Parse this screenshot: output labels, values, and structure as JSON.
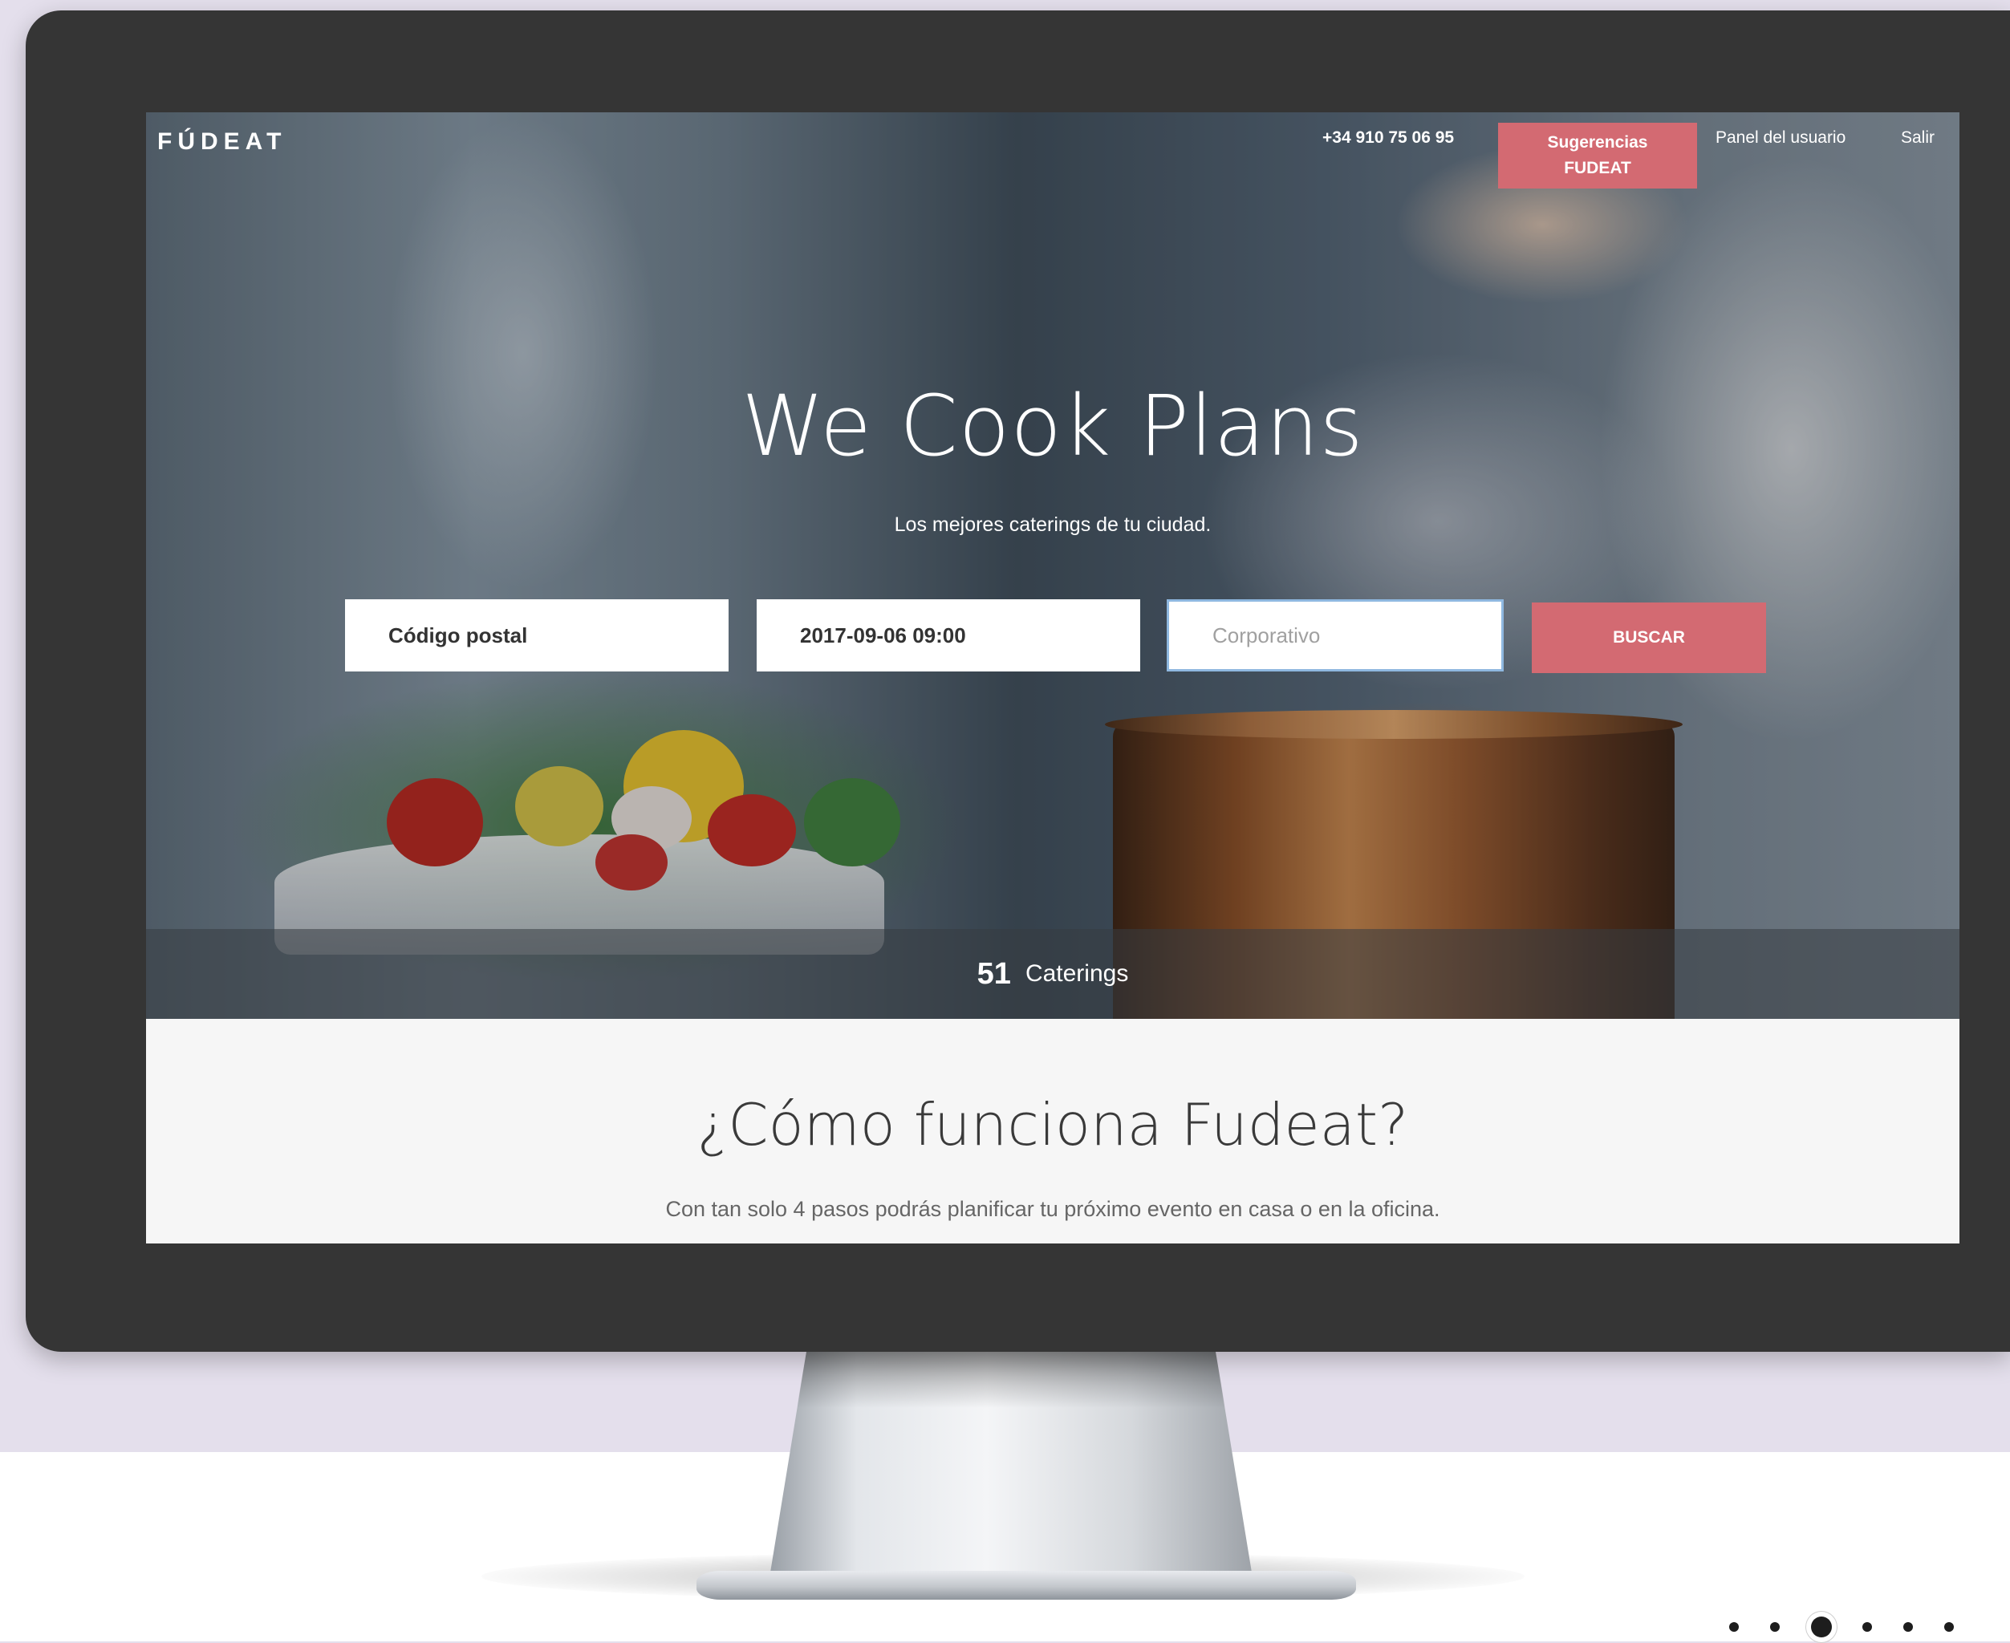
{
  "header": {
    "logo": "FÚDEAT",
    "phone": "+34 910 75 06 95",
    "cta_line1": "Sugerencias",
    "cta_line2": "FUDEAT",
    "panel_link": "Panel del usuario",
    "logout_link": "Salir"
  },
  "hero": {
    "title": "We Cook Plans",
    "subtitle": "Los mejores caterings de tu ciudad."
  },
  "search": {
    "postal_code_value": "Código postal",
    "date_value": "2017-09-06 09:00",
    "event_type_placeholder": "Corporativo",
    "button_label": "BUSCAR"
  },
  "stats": {
    "count": "51",
    "label": "Caterings"
  },
  "how": {
    "title": "¿Cómo funciona Fudeat?",
    "subtitle": "Con tan solo 4 pasos podrás planificar tu próximo evento en casa o en la oficina."
  },
  "carousel": {
    "total": 6,
    "active_index": 2
  },
  "colors": {
    "accent": "#d36a72",
    "frame": "#353535",
    "backdrop": "#e4dfec"
  }
}
